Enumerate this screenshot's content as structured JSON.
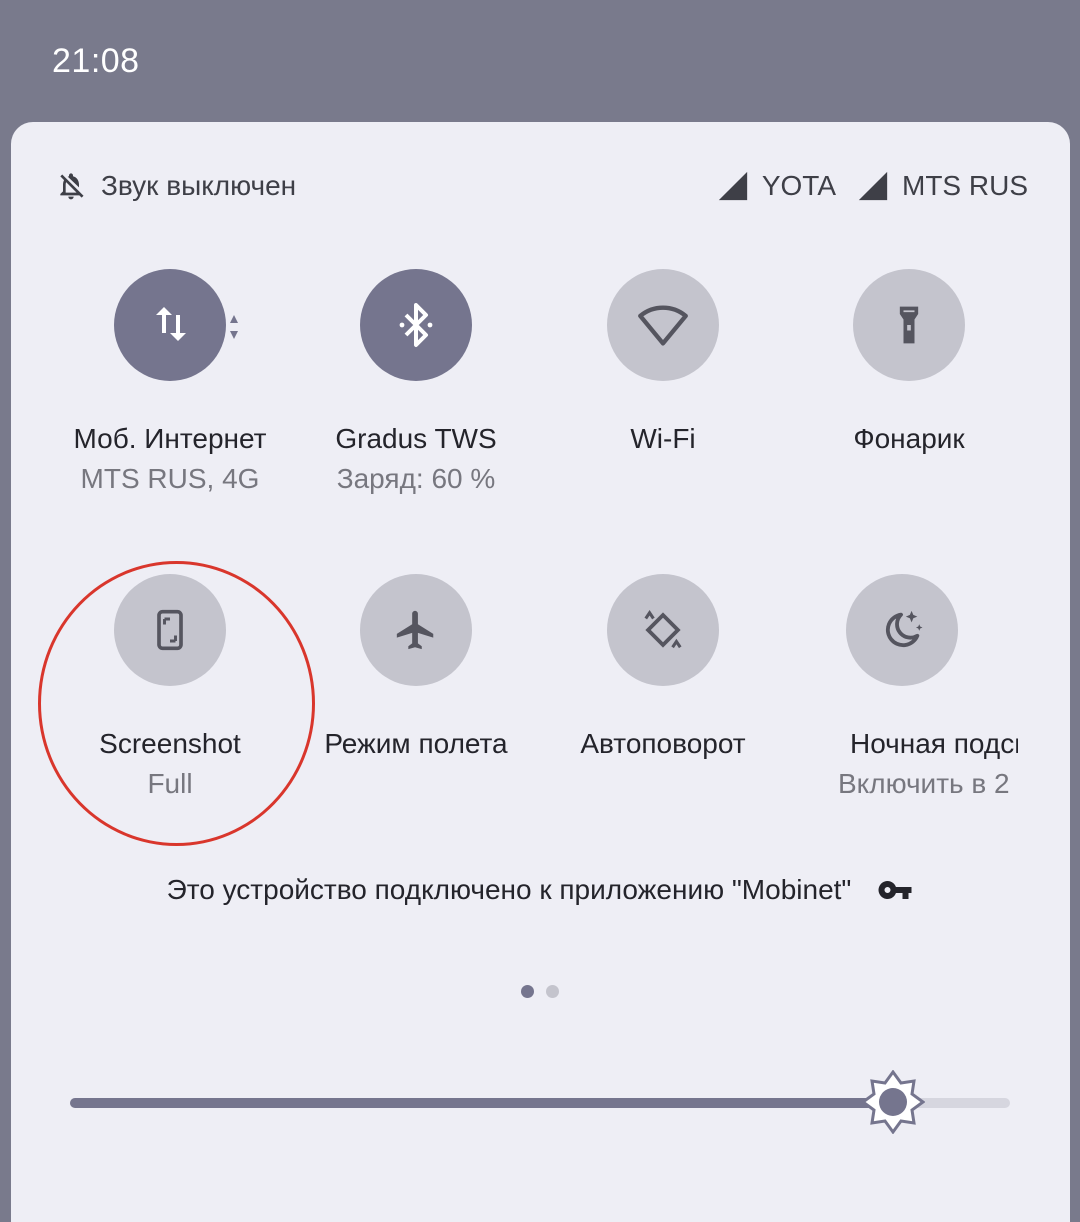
{
  "status_bar": {
    "time": "21:08"
  },
  "header": {
    "ringer_label": "Звук выключен",
    "carriers": [
      "YOTA",
      "MTS RUS"
    ]
  },
  "tiles": [
    {
      "label": "Моб. Интернет",
      "sub": "MTS RUS, 4G",
      "state": "on",
      "icon": "mobile-data-icon"
    },
    {
      "label": "Gradus TWS",
      "sub": "Заряд: 60 %",
      "state": "on",
      "icon": "bluetooth-icon"
    },
    {
      "label": "Wi-Fi",
      "sub": "",
      "state": "off",
      "icon": "wifi-icon"
    },
    {
      "label": "Фонарик",
      "sub": "",
      "state": "off",
      "icon": "flashlight-icon"
    },
    {
      "label": "Screenshot",
      "sub": "Full",
      "state": "off",
      "icon": "screenshot-icon"
    },
    {
      "label": "Режим полета",
      "sub": "",
      "state": "off",
      "icon": "airplane-icon"
    },
    {
      "label": "Автоповорот",
      "sub": "",
      "state": "off",
      "icon": "auto-rotate-icon"
    },
    {
      "label": "Ночная подсветка",
      "sub": "Включить в 2",
      "state": "off",
      "icon": "night-light-icon"
    }
  ],
  "device_note": "Это устройство подключено к приложению \"Mobinet\"",
  "pages": {
    "current": 1,
    "total": 2
  },
  "brightness": {
    "level": 0.875
  },
  "colors": {
    "accent": "#75758e",
    "annotation": "#d9362c",
    "panel": "#eeeef5"
  }
}
